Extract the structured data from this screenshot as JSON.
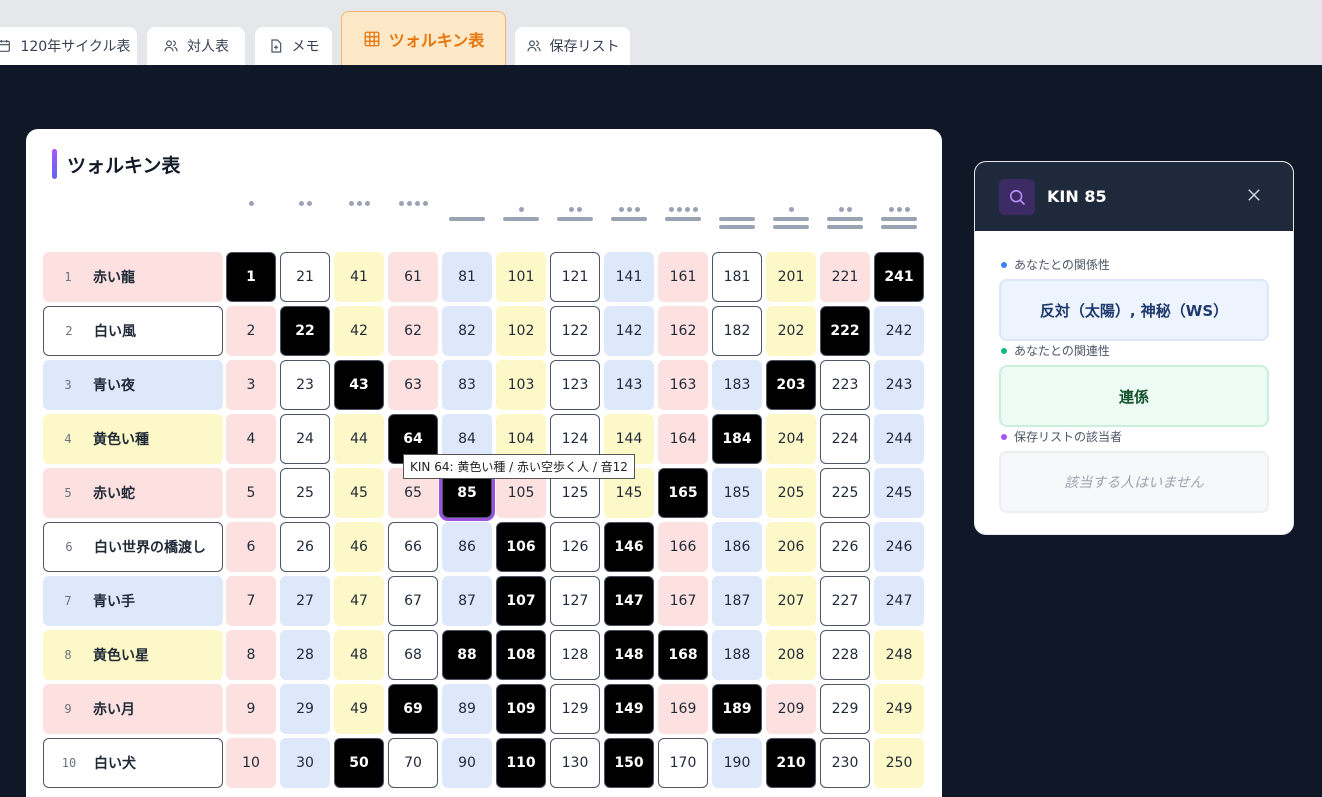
{
  "tabs": [
    {
      "label": "120年サイクル表",
      "icon": "calendar-icon",
      "active": false
    },
    {
      "label": "対人表",
      "icon": "users-icon",
      "active": false
    },
    {
      "label": "メモ",
      "icon": "file-plus-icon",
      "active": false
    },
    {
      "label": "ツォルキン表",
      "icon": "grid-icon",
      "active": true
    },
    {
      "label": "保存リスト",
      "icon": "users-icon",
      "active": false
    }
  ],
  "panel": {
    "title": "ツォルキン表"
  },
  "seals": [
    {
      "num": "1",
      "name": "赤い龍",
      "color": "red"
    },
    {
      "num": "2",
      "name": "白い風",
      "color": "white"
    },
    {
      "num": "3",
      "name": "青い夜",
      "color": "blue"
    },
    {
      "num": "4",
      "name": "黄色い種",
      "color": "yellow"
    },
    {
      "num": "5",
      "name": "赤い蛇",
      "color": "red"
    },
    {
      "num": "6",
      "name": "白い世界の橋渡し",
      "color": "white"
    },
    {
      "num": "7",
      "name": "青い手",
      "color": "blue"
    },
    {
      "num": "8",
      "name": "黄色い星",
      "color": "yellow"
    },
    {
      "num": "9",
      "name": "赤い月",
      "color": "red"
    },
    {
      "num": "10",
      "name": "白い犬",
      "color": "white"
    }
  ],
  "tones": [
    1,
    2,
    3,
    4,
    5,
    6,
    7,
    8,
    9,
    10,
    11,
    12,
    13
  ],
  "grid": [
    [
      {
        "v": "1",
        "c": "black"
      },
      {
        "v": "21",
        "c": "white"
      },
      {
        "v": "41",
        "c": "yellow"
      },
      {
        "v": "61",
        "c": "red"
      },
      {
        "v": "81",
        "c": "blue"
      },
      {
        "v": "101",
        "c": "yellow"
      },
      {
        "v": "121",
        "c": "white"
      },
      {
        "v": "141",
        "c": "blue"
      },
      {
        "v": "161",
        "c": "red"
      },
      {
        "v": "181",
        "c": "white"
      },
      {
        "v": "201",
        "c": "yellow"
      },
      {
        "v": "221",
        "c": "red"
      },
      {
        "v": "241",
        "c": "black"
      }
    ],
    [
      {
        "v": "2",
        "c": "red"
      },
      {
        "v": "22",
        "c": "black"
      },
      {
        "v": "42",
        "c": "yellow"
      },
      {
        "v": "62",
        "c": "red"
      },
      {
        "v": "82",
        "c": "blue"
      },
      {
        "v": "102",
        "c": "yellow"
      },
      {
        "v": "122",
        "c": "white"
      },
      {
        "v": "142",
        "c": "blue"
      },
      {
        "v": "162",
        "c": "red"
      },
      {
        "v": "182",
        "c": "white"
      },
      {
        "v": "202",
        "c": "yellow"
      },
      {
        "v": "222",
        "c": "black"
      },
      {
        "v": "242",
        "c": "blue"
      }
    ],
    [
      {
        "v": "3",
        "c": "red"
      },
      {
        "v": "23",
        "c": "white"
      },
      {
        "v": "43",
        "c": "black"
      },
      {
        "v": "63",
        "c": "red"
      },
      {
        "v": "83",
        "c": "blue"
      },
      {
        "v": "103",
        "c": "yellow"
      },
      {
        "v": "123",
        "c": "white"
      },
      {
        "v": "143",
        "c": "blue"
      },
      {
        "v": "163",
        "c": "red"
      },
      {
        "v": "183",
        "c": "blue"
      },
      {
        "v": "203",
        "c": "black"
      },
      {
        "v": "223",
        "c": "white"
      },
      {
        "v": "243",
        "c": "blue"
      }
    ],
    [
      {
        "v": "4",
        "c": "red"
      },
      {
        "v": "24",
        "c": "white"
      },
      {
        "v": "44",
        "c": "yellow"
      },
      {
        "v": "64",
        "c": "black"
      },
      {
        "v": "84",
        "c": "blue"
      },
      {
        "v": "104",
        "c": "yellow"
      },
      {
        "v": "124",
        "c": "white"
      },
      {
        "v": "144",
        "c": "yellow"
      },
      {
        "v": "164",
        "c": "red"
      },
      {
        "v": "184",
        "c": "black"
      },
      {
        "v": "204",
        "c": "yellow"
      },
      {
        "v": "224",
        "c": "white"
      },
      {
        "v": "244",
        "c": "blue"
      }
    ],
    [
      {
        "v": "5",
        "c": "red"
      },
      {
        "v": "25",
        "c": "white"
      },
      {
        "v": "45",
        "c": "yellow"
      },
      {
        "v": "65",
        "c": "red"
      },
      {
        "v": "85",
        "c": "black",
        "sel": true
      },
      {
        "v": "105",
        "c": "red"
      },
      {
        "v": "125",
        "c": "white"
      },
      {
        "v": "145",
        "c": "yellow"
      },
      {
        "v": "165",
        "c": "black"
      },
      {
        "v": "185",
        "c": "blue"
      },
      {
        "v": "205",
        "c": "yellow"
      },
      {
        "v": "225",
        "c": "white"
      },
      {
        "v": "245",
        "c": "blue"
      }
    ],
    [
      {
        "v": "6",
        "c": "red"
      },
      {
        "v": "26",
        "c": "white"
      },
      {
        "v": "46",
        "c": "yellow"
      },
      {
        "v": "66",
        "c": "white"
      },
      {
        "v": "86",
        "c": "blue"
      },
      {
        "v": "106",
        "c": "black"
      },
      {
        "v": "126",
        "c": "white"
      },
      {
        "v": "146",
        "c": "black"
      },
      {
        "v": "166",
        "c": "red"
      },
      {
        "v": "186",
        "c": "blue"
      },
      {
        "v": "206",
        "c": "yellow"
      },
      {
        "v": "226",
        "c": "white"
      },
      {
        "v": "246",
        "c": "blue"
      }
    ],
    [
      {
        "v": "7",
        "c": "red"
      },
      {
        "v": "27",
        "c": "blue"
      },
      {
        "v": "47",
        "c": "yellow"
      },
      {
        "v": "67",
        "c": "white"
      },
      {
        "v": "87",
        "c": "blue"
      },
      {
        "v": "107",
        "c": "black"
      },
      {
        "v": "127",
        "c": "white"
      },
      {
        "v": "147",
        "c": "black"
      },
      {
        "v": "167",
        "c": "red"
      },
      {
        "v": "187",
        "c": "blue"
      },
      {
        "v": "207",
        "c": "yellow"
      },
      {
        "v": "227",
        "c": "white"
      },
      {
        "v": "247",
        "c": "blue"
      }
    ],
    [
      {
        "v": "8",
        "c": "red"
      },
      {
        "v": "28",
        "c": "blue"
      },
      {
        "v": "48",
        "c": "yellow"
      },
      {
        "v": "68",
        "c": "white"
      },
      {
        "v": "88",
        "c": "black"
      },
      {
        "v": "108",
        "c": "black"
      },
      {
        "v": "128",
        "c": "white"
      },
      {
        "v": "148",
        "c": "black"
      },
      {
        "v": "168",
        "c": "black"
      },
      {
        "v": "188",
        "c": "blue"
      },
      {
        "v": "208",
        "c": "yellow"
      },
      {
        "v": "228",
        "c": "white"
      },
      {
        "v": "248",
        "c": "yellow"
      }
    ],
    [
      {
        "v": "9",
        "c": "red"
      },
      {
        "v": "29",
        "c": "blue"
      },
      {
        "v": "49",
        "c": "yellow"
      },
      {
        "v": "69",
        "c": "black"
      },
      {
        "v": "89",
        "c": "blue"
      },
      {
        "v": "109",
        "c": "black"
      },
      {
        "v": "129",
        "c": "white"
      },
      {
        "v": "149",
        "c": "black"
      },
      {
        "v": "169",
        "c": "red"
      },
      {
        "v": "189",
        "c": "black"
      },
      {
        "v": "209",
        "c": "red"
      },
      {
        "v": "229",
        "c": "white"
      },
      {
        "v": "249",
        "c": "yellow"
      }
    ],
    [
      {
        "v": "10",
        "c": "red"
      },
      {
        "v": "30",
        "c": "blue"
      },
      {
        "v": "50",
        "c": "black"
      },
      {
        "v": "70",
        "c": "white"
      },
      {
        "v": "90",
        "c": "blue"
      },
      {
        "v": "110",
        "c": "black"
      },
      {
        "v": "130",
        "c": "white"
      },
      {
        "v": "150",
        "c": "black"
      },
      {
        "v": "170",
        "c": "white"
      },
      {
        "v": "190",
        "c": "blue"
      },
      {
        "v": "210",
        "c": "black"
      },
      {
        "v": "230",
        "c": "white"
      },
      {
        "v": "250",
        "c": "yellow"
      }
    ]
  ],
  "tooltip": "KIN 64: 黄色い種 / 赤い空歩く人 / 音12",
  "card": {
    "title": "KIN 85",
    "relation_label": "あなたとの関係性",
    "relation_value": "反対（太陽）, 神秘（WS）",
    "connection_label": "あなたとの関連性",
    "connection_value": "連係",
    "saved_label": "保存リストの該当者",
    "saved_value": "該当する人はいません"
  },
  "colors": {
    "red": "#fde0e0",
    "white": "#ffffff",
    "blue": "#dde9fb",
    "yellow": "#fdf8c7",
    "relation_dot": "#3b82f6",
    "connection_dot": "#10b981",
    "saved_dot": "#a855f7",
    "accent": "#e8750a"
  }
}
